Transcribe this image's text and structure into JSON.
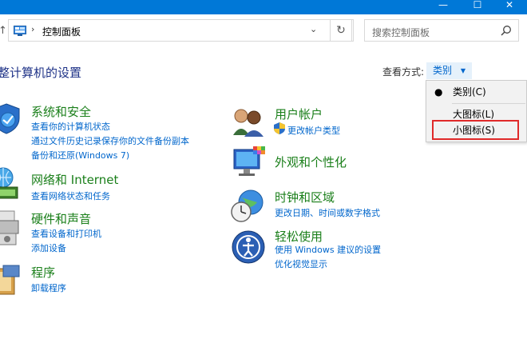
{
  "window": {
    "minimize_glyph": "—",
    "maximize_glyph": "☐",
    "close_glyph": "✕"
  },
  "address": {
    "separator": "›",
    "path": "控制面板",
    "dropdown_glyph": "⌄",
    "refresh_glyph": "↻",
    "search_placeholder": "搜索控制面板",
    "up_glyph": "↑"
  },
  "header": {
    "title": "整计算机的设置",
    "view_by_label": "查看方式:",
    "view_by_value": "类别",
    "caret": "▼"
  },
  "view_menu": {
    "items": [
      {
        "label": "类别(C)",
        "selected": true,
        "bullet": "●"
      },
      {
        "label": "大图标(L)",
        "selected": false
      },
      {
        "label": "小图标(S)",
        "selected": false
      }
    ]
  },
  "categories": {
    "system": {
      "title": "系统和安全",
      "links": [
        "查看你的计算机状态",
        "通过文件历史记录保存你的文件备份副本",
        "备份和还原(Windows 7)"
      ]
    },
    "network": {
      "title": "网络和 Internet",
      "links": [
        "查看网络状态和任务"
      ]
    },
    "hardware": {
      "title": "硬件和声音",
      "links": [
        "查看设备和打印机",
        "添加设备"
      ]
    },
    "programs": {
      "title": "程序",
      "links": [
        "卸载程序"
      ]
    },
    "users": {
      "title": "用户帐户",
      "links": [
        "更改帐户类型"
      ]
    },
    "appearance": {
      "title": "外观和个性化",
      "links": []
    },
    "clock": {
      "title": "时钟和区域",
      "links": [
        "更改日期、时间或数字格式"
      ]
    },
    "ease": {
      "title": "轻松使用",
      "links": [
        "使用 Windows 建议的设置",
        "优化视觉显示"
      ]
    }
  },
  "colors": {
    "titlebar": "#0078d7",
    "category_title": "#1a7f1a",
    "link": "#0066cc",
    "highlight_box": "#e02a2a"
  }
}
